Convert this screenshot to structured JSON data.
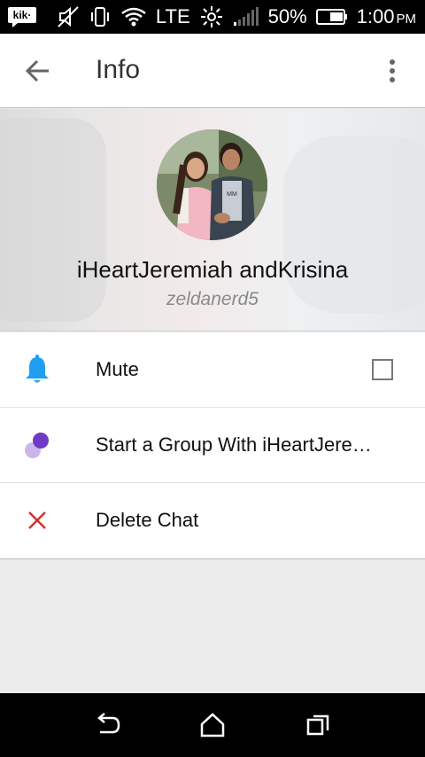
{
  "status_bar": {
    "app_logo_text": "kik·",
    "network": "LTE",
    "battery": "50%",
    "time": "1:00",
    "ampm": "PM"
  },
  "app_bar": {
    "title": "Info"
  },
  "profile": {
    "display_name": "iHeartJeremiah andKrisina",
    "username": "zeldanerd5"
  },
  "options": [
    {
      "label": "Mute",
      "icon": "bell-icon",
      "checked": false
    },
    {
      "label": "Start a Group With iHeartJere…",
      "icon": "group-icon"
    },
    {
      "label": "Delete Chat",
      "icon": "close-icon"
    }
  ],
  "colors": {
    "accent_blue": "#1e9ff2",
    "group_purple": "#6f3ac4",
    "delete_red": "#d32f2f"
  }
}
